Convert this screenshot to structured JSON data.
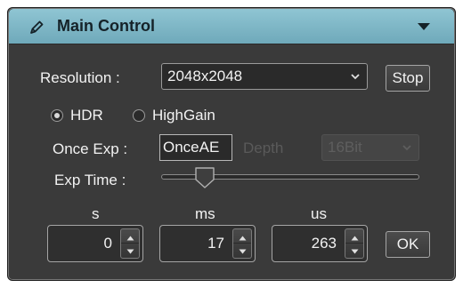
{
  "window": {
    "title": "Main Control",
    "title_icon": "pencil-icon",
    "collapse_icon": "triangle-down-icon"
  },
  "resolution": {
    "label": "Resolution :",
    "value": "2048x2048",
    "stop_label": "Stop"
  },
  "mode": {
    "options": [
      "HDR",
      "HighGain"
    ],
    "selected": "HDR"
  },
  "once_exp": {
    "label": "Once Exp :",
    "value": "OnceAE",
    "depth_label": "Depth",
    "depth_value": "16Bit",
    "depth_enabled": false
  },
  "exp_time": {
    "label": "Exp Time :",
    "slider_fraction": 0.14
  },
  "time_fields": {
    "s": {
      "label": "s",
      "value": "0"
    },
    "ms": {
      "label": "ms",
      "value": "17"
    },
    "us": {
      "label": "us",
      "value": "263"
    },
    "ok_label": "OK"
  }
}
